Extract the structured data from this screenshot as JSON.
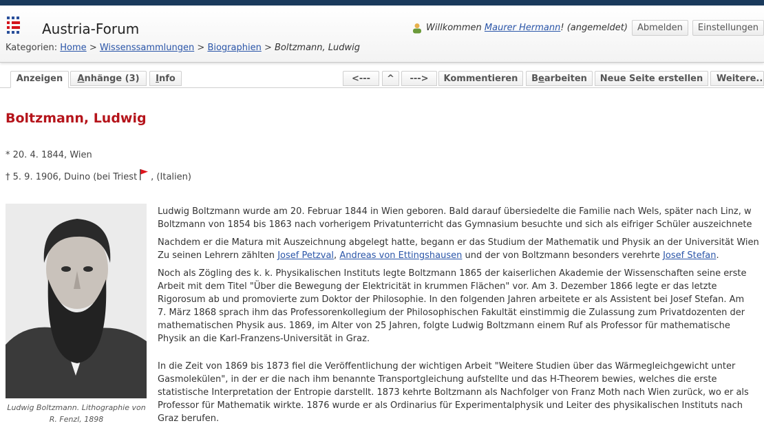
{
  "header": {
    "site_title": "Austria-Forum",
    "breadcrumb": {
      "prefix": "Kategorien:",
      "home": "Home",
      "sep": ">",
      "collections": "Wissenssammlungen",
      "biographies": "Biographien",
      "current": "Boltzmann, Ludwig"
    },
    "user": {
      "welcome_prefix": "Willkommen",
      "name": "Maurer Hermann",
      "welcome_suffix": "! (angemeldet)",
      "logout": "Abmelden",
      "settings": "Einstellungen"
    }
  },
  "tabs": {
    "view": "Anzeigen",
    "attachments_accel": "A",
    "attachments_rest": "nhänge (3)",
    "info_accel": "I",
    "info_rest": "nfo"
  },
  "actions": {
    "prev": "<---",
    "up": "^",
    "next": "--->",
    "comment": "Kommentieren",
    "edit_pre": "B",
    "edit_accel": "e",
    "edit_post": "arbeiten",
    "new_page": "Neue Seite erstellen",
    "more": "Weitere..."
  },
  "page": {
    "title": "Boltzmann, Ludwig",
    "born": "* 20. 4. 1844, Wien",
    "died_pre": "† 5. 9. 1906, Duino (bei Triest",
    "died_post": ", (Italien)",
    "caption": "Ludwig Boltzmann. Lithographie von R. Fenzl, 1898"
  },
  "article": {
    "p1_l1": "Ludwig Boltzmann wurde am 20. Februar 1844 in Wien geboren. Bald darauf übersiedelte die Familie nach Wels, später nach Linz, w",
    "p1_l2": "Boltzmann von 1854 bis 1863 nach vorherigem Privatunterricht das Gymnasium besuchte und sich als eifriger Schüler auszeichnete",
    "p2_l1": "Nachdem er die Matura mit Auszeichnung abgelegt hatte, begann er das Studium der Mathematik und Physik an der Universität Wien",
    "p2_l2_pre": "Zu seinen Lehrern zählten",
    "link_petzval": "Josef Petzval",
    "comma": ",",
    "link_ettingshausen": "Andreas von Ettingshausen",
    "p2_l2_mid": "und der von Boltzmann besonders verehrte",
    "link_stefan": "Josef Stefan",
    "period": ".",
    "p3_l1": "Noch als Zögling des k. k. Physikalischen Instituts legte Boltzmann 1865 der kaiserlichen Akademie der Wissenschaften seine erste",
    "p3_l2": "Arbeit mit dem Titel \"Über die Bewegung der Elektricität in krummen Flächen\" vor. Am 3. Dezember 1866 legte er das letzte",
    "p3_l3": "Rigorosum ab und promovierte zum Doktor der Philosophie. In den folgenden Jahren arbeitete er als Assistent bei Josef Stefan. Am",
    "p3_l4": "7. März 1868 sprach ihm das Professorenkollegium der Philosophischen Fakultät einstimmig die Zulassung zum Privatdozenten der",
    "p3_l5": "mathematischen Physik aus. 1869, im Alter von 25 Jahren, folgte Ludwig Boltzmann einem Ruf als Professor für mathematische",
    "p3_l6": "Physik an die Karl-Franzens-Universität in Graz.",
    "p4_l1": "In die Zeit von 1869 bis 1873 fiel die Veröffentlichung der wichtigen Arbeit \"Weitere Studien über das Wärmegleichgewicht unter",
    "p4_l2": "Gasmolekülen\", in der er die nach ihm benannte Transportgleichung aufstellte und das H-Theorem bewies, welches die erste",
    "p4_l3": "statistische Interpretation der Entropie darstellt. 1873 kehrte Boltzmann als Nachfolger von Franz Moth nach Wien zurück, wo er als",
    "p4_l4": "Professor für Mathematik wirkte. 1876 wurde er als Ordinarius für Experimentalphysik und Leiter des physikalischen Instituts nach",
    "p4_l5": "Graz berufen."
  },
  "colors": {
    "title_red": "#b5141b",
    "link_blue": "#2a55a8",
    "topbar": "#1a3a5c"
  },
  "icons": [
    "austria-forum-logo-icon",
    "user-icon",
    "red-flag-icon"
  ]
}
